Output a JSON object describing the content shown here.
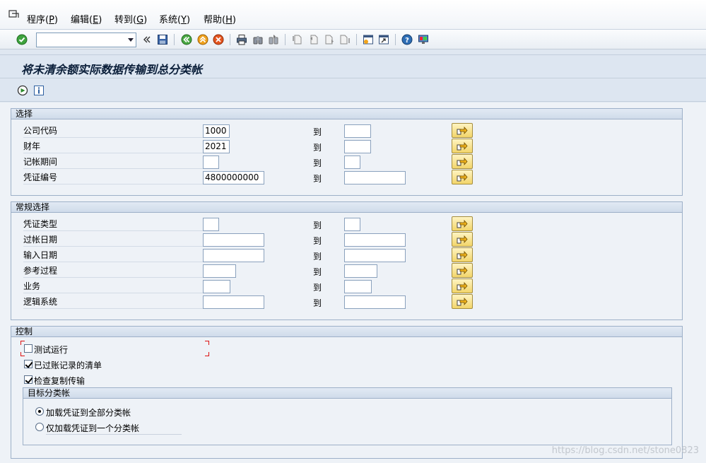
{
  "menu": {
    "items": [
      {
        "label": "程序(",
        "key": "P",
        "close": ")"
      },
      {
        "label": "编辑(",
        "key": "E",
        "close": ")"
      },
      {
        "label": "转到(",
        "key": "G",
        "close": ")"
      },
      {
        "label": "系统(",
        "key": "Y",
        "close": ")"
      },
      {
        "label": "帮助(",
        "key": "H",
        "close": ")"
      }
    ]
  },
  "toolbar": {
    "command_value": "",
    "icons": [
      "enter-icon",
      "back-double-chevron-icon",
      "save-icon",
      "back-icon",
      "exit-icon",
      "cancel-icon",
      "print-icon",
      "find-icon",
      "find-next-icon",
      "first-page-icon",
      "previous-page-icon",
      "next-page-icon",
      "last-page-icon",
      "create-session-icon",
      "shortcut-icon",
      "help-icon",
      "customize-layout-icon"
    ]
  },
  "title": "将未清余额实际数据传输到总分类帐",
  "app_toolbar": {
    "icons": [
      "execute-icon",
      "info-icon"
    ]
  },
  "selection": {
    "header": "选择",
    "to_label": "到",
    "rows": [
      {
        "label": "公司代码",
        "low": "1000",
        "high": ""
      },
      {
        "label": "财年",
        "low": "2021",
        "high": ""
      },
      {
        "label": "记帐期间",
        "low": "",
        "high": ""
      },
      {
        "label": "凭证编号",
        "low": "4800000000",
        "high": ""
      }
    ]
  },
  "general": {
    "header": "常规选择",
    "to_label": "到",
    "rows": [
      {
        "label": "凭证类型",
        "low": "",
        "high": ""
      },
      {
        "label": "过帐日期",
        "low": "",
        "high": ""
      },
      {
        "label": "输入日期",
        "low": "",
        "high": ""
      },
      {
        "label": "参考过程",
        "low": "",
        "high": ""
      },
      {
        "label": "业务",
        "low": "",
        "high": ""
      },
      {
        "label": "逻辑系统",
        "low": "",
        "high": ""
      }
    ]
  },
  "control": {
    "header": "控制",
    "checkboxes": [
      {
        "label": "测试运行",
        "checked": false
      },
      {
        "label": "已过账记录的清单",
        "checked": true
      },
      {
        "label": "检查复制传输",
        "checked": true
      }
    ],
    "target_ledger": {
      "header": "目标分类帐",
      "options": [
        {
          "label": "加载凭证到全部分类帐",
          "selected": true
        },
        {
          "label": "仅加载凭证到一个分类帐",
          "selected": false
        }
      ]
    }
  },
  "watermark": "https://blog.csdn.net/stone0823"
}
